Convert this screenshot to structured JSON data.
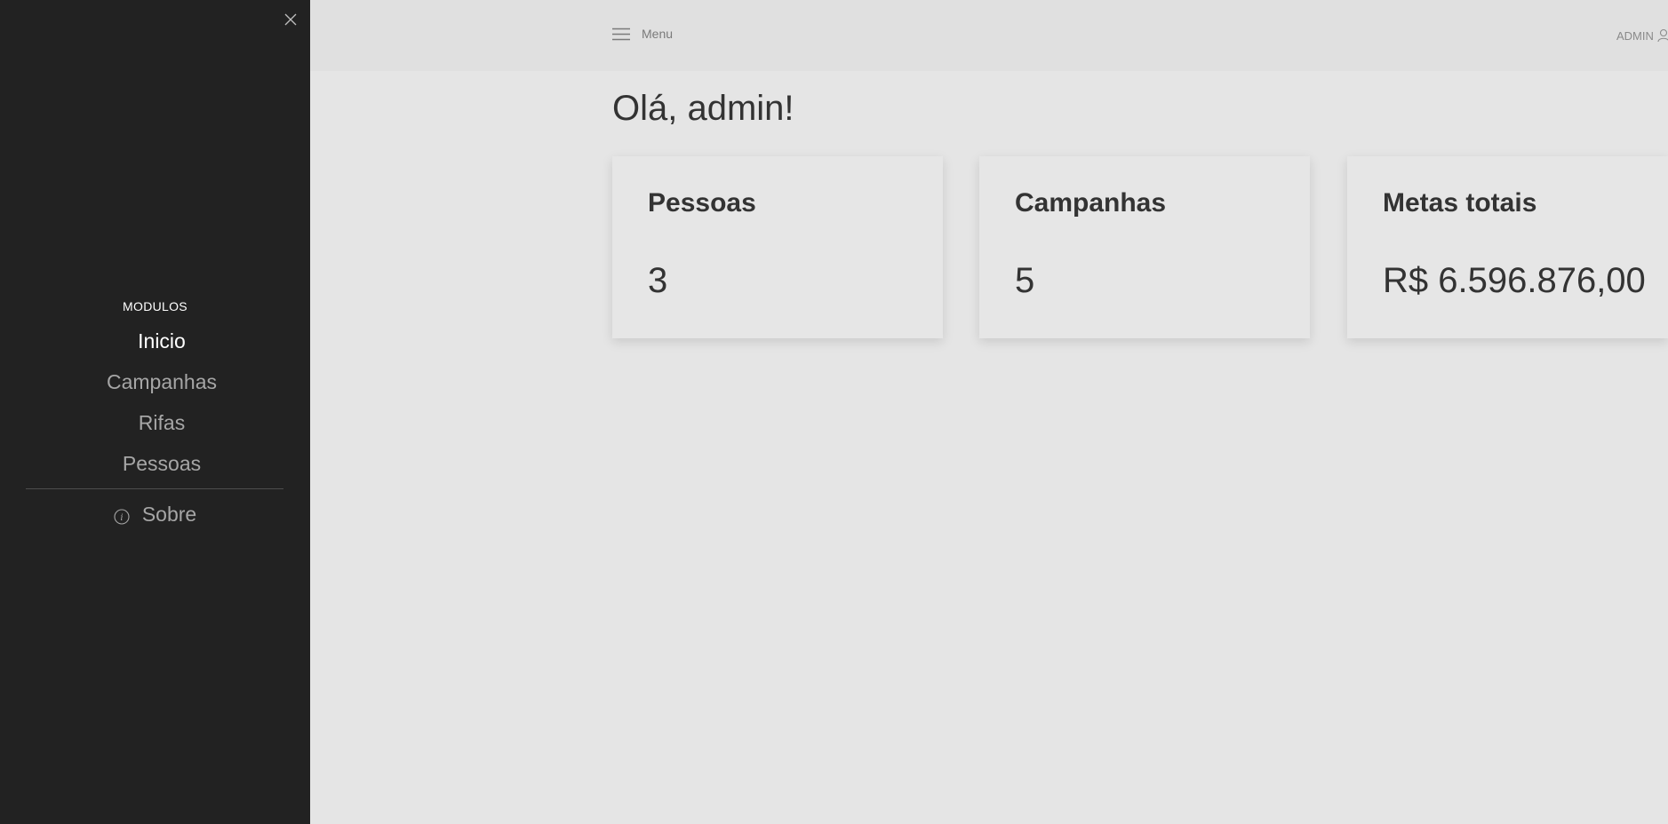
{
  "sidebar": {
    "section_title": "MODULOS",
    "items": [
      {
        "label": "Inicio",
        "active": true
      },
      {
        "label": "Campanhas",
        "active": false
      },
      {
        "label": "Rifas",
        "active": false
      },
      {
        "label": "Pessoas",
        "active": false
      }
    ],
    "about_label": "Sobre"
  },
  "header": {
    "menu_label": "Menu",
    "user_label": "ADMIN"
  },
  "main": {
    "greeting": "Olá, admin!",
    "cards": [
      {
        "title": "Pessoas",
        "value": "3"
      },
      {
        "title": "Campanhas",
        "value": "5"
      },
      {
        "title": "Metas totais",
        "value": "R$ 6.596.876,00"
      }
    ]
  },
  "colors": {
    "sidebar_bg": "#222222",
    "page_bg": "#e5e5e5",
    "topbar_bg": "#e0e0e0",
    "text_dark": "#333333",
    "nav_inactive": "#a6a6a6"
  }
}
